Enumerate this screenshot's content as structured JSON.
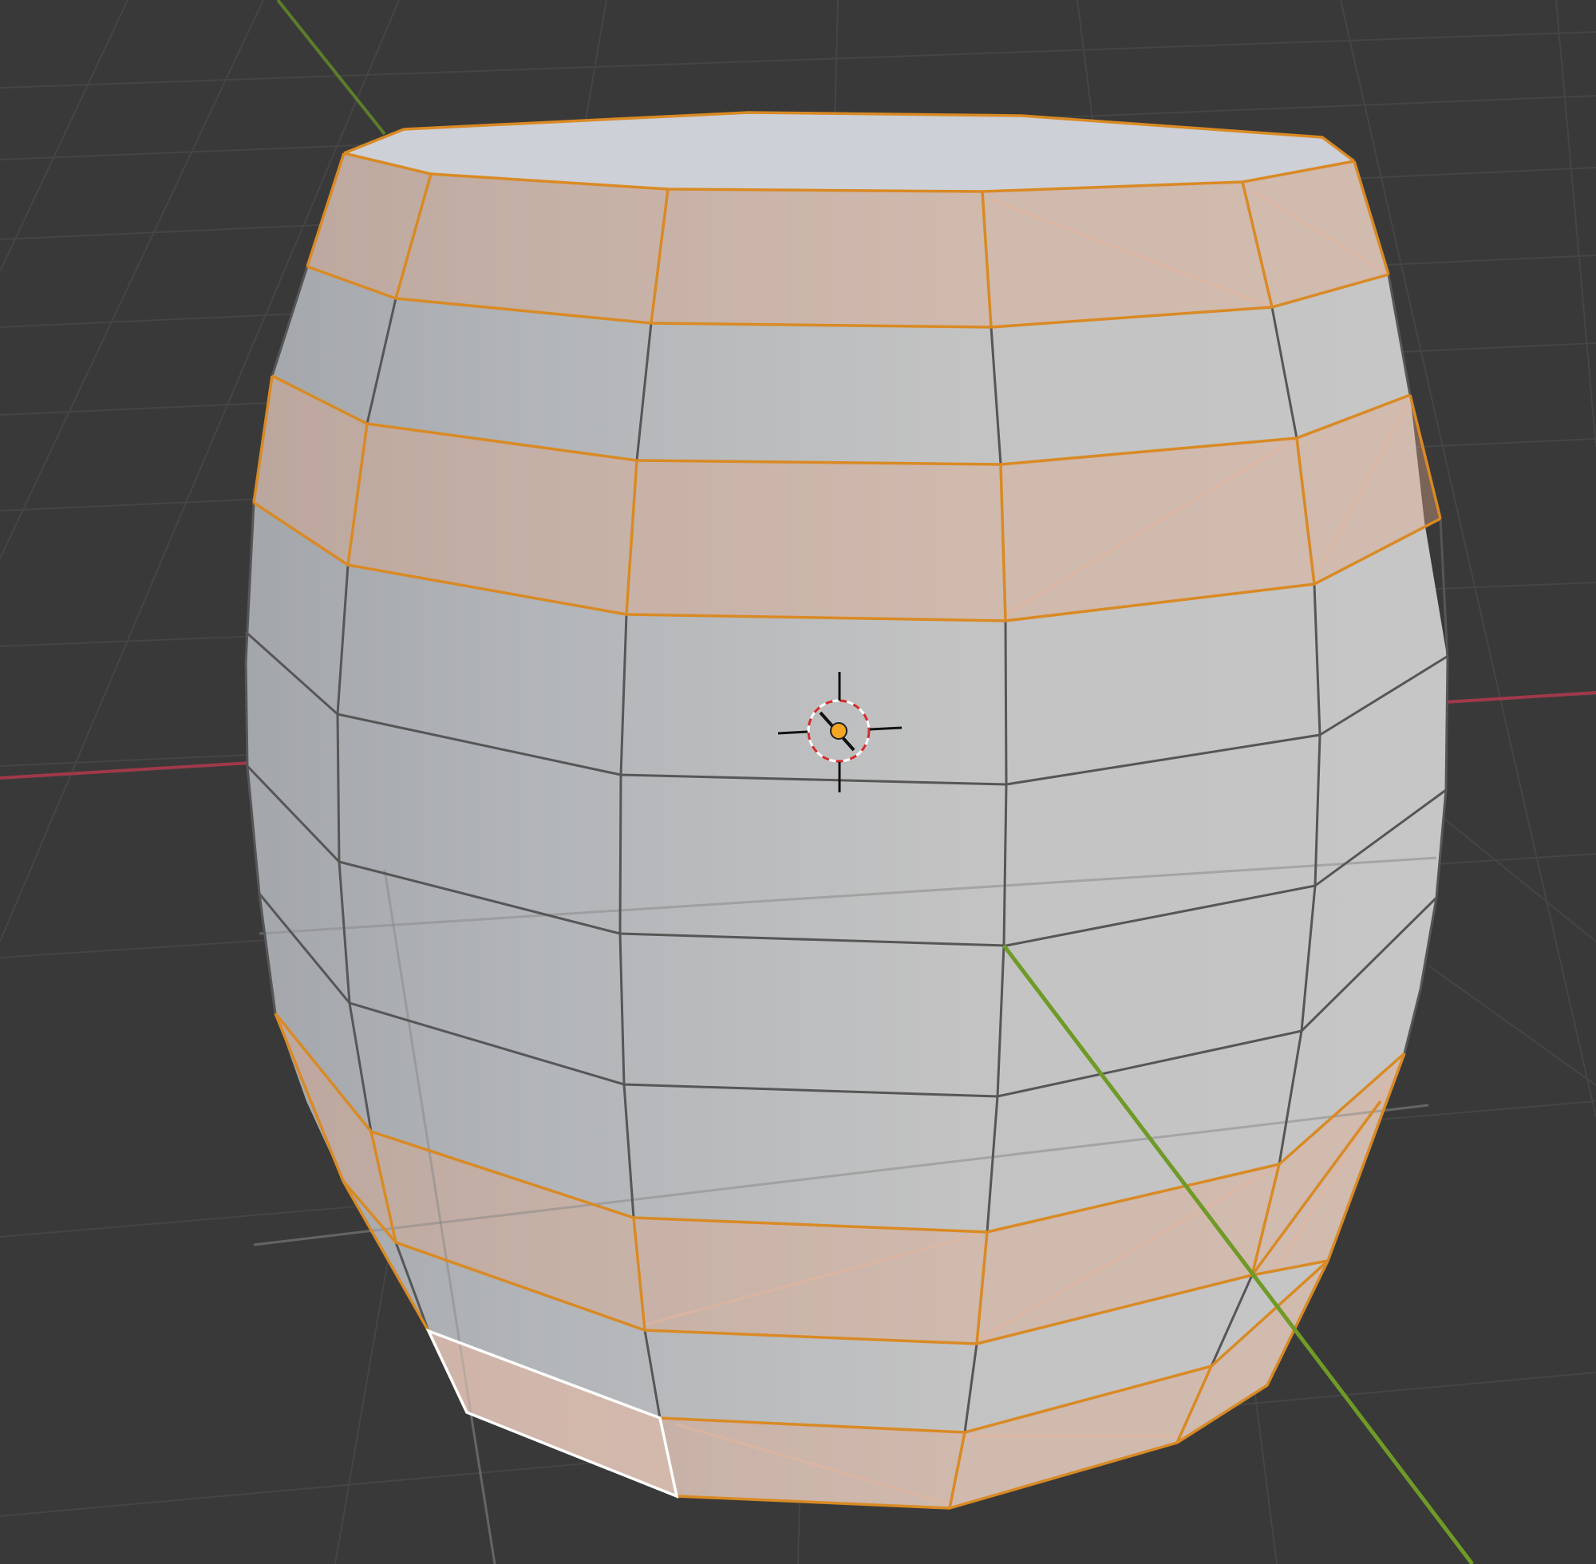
{
  "viewport": {
    "view": "3d-viewport",
    "mode": "edit-mode",
    "object": "barrel-mesh",
    "cursor_icon": "3d-cursor-icon",
    "origin_icon": "object-origin-icon"
  },
  "colors": {
    "background": "#393939",
    "grid_line": "#4a4a4a",
    "x_axis": "#a0394a",
    "y_axis": "#6f9a27",
    "edge_unselected": "#555555",
    "edge_selected": "#e08a1e",
    "edge_active": "#ffffff",
    "face_base": "#bcbcbe",
    "face_top": "#cdd0d6",
    "face_selected_tint": "#e4a88a",
    "origin_dot": "#f5a623",
    "cursor_ring_red": "#d22b2b",
    "cursor_ring_white": "#ffffff"
  }
}
